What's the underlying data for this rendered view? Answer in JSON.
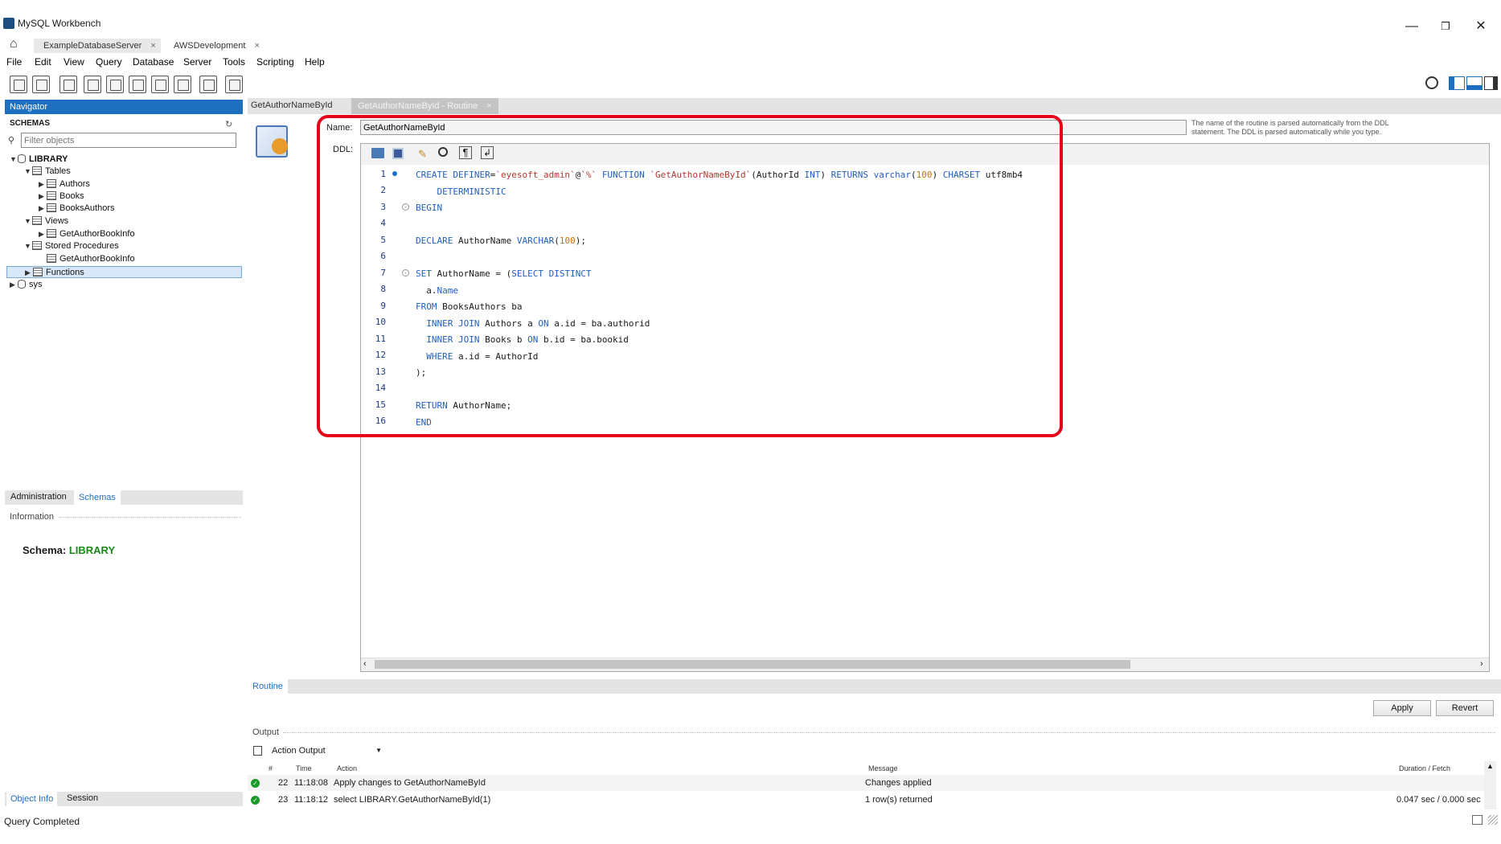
{
  "window": {
    "title": "MySQL Workbench"
  },
  "connections": [
    {
      "label": "ExampleDatabaseServer"
    },
    {
      "label": "AWSDevelopment"
    }
  ],
  "menu": [
    "File",
    "Edit",
    "View",
    "Query",
    "Database",
    "Server",
    "Tools",
    "Scripting",
    "Help"
  ],
  "navigator": {
    "header": "Navigator",
    "schemas_label": "SCHEMAS",
    "filter_placeholder": "Filter objects",
    "tree": {
      "library": "LIBRARY",
      "tables": "Tables",
      "table_items": [
        "Authors",
        "Books",
        "BooksAuthors"
      ],
      "views": "Views",
      "view_items": [
        "GetAuthorBookInfo"
      ],
      "procedures": "Stored Procedures",
      "procedure_items": [
        "GetAuthorBookInfo"
      ],
      "functions": "Functions",
      "sys": "sys"
    },
    "bottom_tabs": [
      "Administration",
      "Schemas"
    ],
    "info_label": "Information",
    "schema_prefix": "Schema:",
    "schema_name": "LIBRARY",
    "object_tabs": [
      "Object Info",
      "Session"
    ]
  },
  "editor_tabs": [
    {
      "label": "GetAuthorNameById"
    },
    {
      "label": "GetAuthorNameById - Routine"
    }
  ],
  "routine": {
    "name_label": "Name:",
    "name_value": "GetAuthorNameById",
    "hint": "The name of the routine is parsed automatically from the DDL statement. The DDL is parsed automatically while you type.",
    "ddl_label": "DDL:",
    "line_numbers": [
      "1",
      "2",
      "3",
      "4",
      "5",
      "6",
      "7",
      "8",
      "9",
      "10",
      "11",
      "12",
      "13",
      "14",
      "15",
      "16"
    ],
    "bottom_tab": "Routine",
    "apply_label": "Apply",
    "revert_label": "Revert"
  },
  "output": {
    "label": "Output",
    "dropdown": "Action Output",
    "columns": [
      "#",
      "Time",
      "Action",
      "Message",
      "Duration / Fetch"
    ],
    "rows": [
      {
        "num": "22",
        "time": "11:18:08",
        "action": "Apply changes to GetAuthorNameById",
        "message": "Changes applied",
        "duration": ""
      },
      {
        "num": "23",
        "time": "11:18:12",
        "action": "select LIBRARY.GetAuthorNameById(1)",
        "message": "1 row(s) returned",
        "duration": "0.047 sec / 0.000 sec"
      }
    ]
  },
  "status": {
    "text": "Query Completed"
  },
  "colors": {
    "accent": "#1f6fc0",
    "highlight": "#e8001a",
    "keyword": "#1f5fbf",
    "number": "#d07000",
    "schema_name": "#1a8a1a"
  }
}
